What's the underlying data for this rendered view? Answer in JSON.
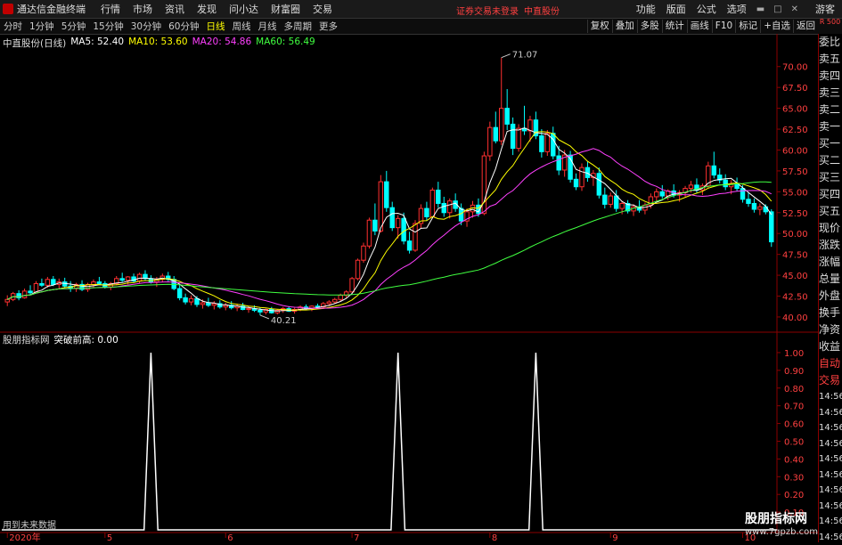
{
  "menubar": {
    "app_title": "通达信金融终端",
    "items": [
      "行情",
      "市场",
      "资讯",
      "发现",
      "问小达",
      "财富圈",
      "交易"
    ],
    "login_note": "证券交易未登录",
    "stock_name": "中直股份",
    "right_items": [
      "功能",
      "版面",
      "公式",
      "选项"
    ],
    "guest": "游客"
  },
  "toolbar": {
    "periods": [
      "分时",
      "1分钟",
      "5分钟",
      "15分钟",
      "30分钟",
      "60分钟",
      "日线",
      "周线",
      "月线",
      "多周期",
      "更多"
    ],
    "active": "日线",
    "right_buttons": [
      "复权",
      "叠加",
      "多股",
      "统计",
      "画线",
      "F10",
      "标记",
      "+自选",
      "返回"
    ],
    "side_tab": "R 500"
  },
  "info": {
    "stock": "中直股份(日线)",
    "ma5_label": "MA5: 52.40",
    "ma10_label": "MA10: 53.60",
    "ma20_label": "MA20: 54.86",
    "ma60_label": "MA60: 56.49",
    "ma5_color": "#ffffff",
    "ma10_color": "#ffff00",
    "ma20_color": "#ff40ff",
    "ma60_color": "#40ff40"
  },
  "indicator": {
    "name": "股朋指标网",
    "field": "突破前高: 0.00"
  },
  "price_annotations": {
    "high": "71.07",
    "low": "40.21"
  },
  "future_data": "用到未来数据",
  "side_panel": [
    "委比",
    "卖五",
    "卖四",
    "卖三",
    "卖二",
    "卖一",
    "买一",
    "买二",
    "买三",
    "买四",
    "买五",
    "现价",
    "涨跌",
    "涨幅",
    "总量",
    "外盘",
    "换手",
    "净资",
    "收益",
    "自动",
    "交易",
    "14:56",
    "14:56",
    "14:56",
    "14:56",
    "14:56",
    "14:56",
    "14:56",
    "14:56",
    "14:56",
    "14:56"
  ],
  "watermark": {
    "main": "股朋指标网",
    "sub": "www.7gpzb.com"
  },
  "chart_data": [
    {
      "type": "candlestick",
      "y_ticks": [
        40.0,
        42.5,
        45.0,
        47.5,
        50.0,
        52.5,
        55.0,
        57.5,
        60.0,
        62.5,
        65.0,
        67.5,
        70.0
      ],
      "ylim": [
        38.5,
        72.0
      ],
      "x_labels": [
        {
          "label": "2020年",
          "index": 0
        },
        {
          "label": "5",
          "index": 17
        },
        {
          "label": "6",
          "index": 38
        },
        {
          "label": "7",
          "index": 60
        },
        {
          "label": "8",
          "index": 84
        },
        {
          "label": "9",
          "index": 105
        },
        {
          "label": "10",
          "index": 128
        }
      ],
      "candles": [
        [
          41.8,
          42.6,
          41.3,
          42.1
        ],
        [
          42.1,
          43.0,
          41.9,
          42.8
        ],
        [
          42.8,
          43.2,
          42.0,
          42.3
        ],
        [
          42.3,
          43.4,
          42.2,
          43.1
        ],
        [
          43.1,
          43.8,
          42.7,
          42.9
        ],
        [
          42.9,
          44.3,
          42.8,
          44.0
        ],
        [
          44.0,
          44.6,
          43.6,
          43.8
        ],
        [
          43.8,
          44.8,
          43.5,
          44.5
        ],
        [
          44.5,
          44.9,
          43.7,
          43.9
        ],
        [
          43.9,
          44.6,
          43.4,
          44.2
        ],
        [
          44.2,
          44.7,
          43.5,
          43.7
        ],
        [
          43.7,
          44.3,
          43.0,
          43.4
        ],
        [
          43.4,
          44.1,
          43.0,
          43.9
        ],
        [
          43.9,
          44.4,
          43.1,
          43.3
        ],
        [
          43.3,
          44.1,
          43.0,
          43.9
        ],
        [
          43.9,
          44.5,
          43.5,
          44.2
        ],
        [
          44.2,
          44.8,
          43.9,
          44.0
        ],
        [
          44.0,
          44.3,
          43.4,
          43.6
        ],
        [
          43.6,
          44.2,
          43.2,
          44.0
        ],
        [
          44.0,
          44.9,
          43.8,
          44.6
        ],
        [
          44.6,
          45.3,
          44.2,
          44.4
        ],
        [
          44.4,
          44.9,
          43.9,
          44.8
        ],
        [
          44.8,
          45.2,
          44.1,
          44.3
        ],
        [
          44.3,
          45.3,
          44.0,
          45.1
        ],
        [
          45.1,
          45.6,
          44.4,
          44.6
        ],
        [
          44.6,
          45.0,
          44.0,
          44.2
        ],
        [
          44.2,
          44.8,
          43.6,
          44.5
        ],
        [
          44.5,
          45.2,
          44.2,
          44.9
        ],
        [
          44.9,
          45.4,
          44.3,
          44.5
        ],
        [
          44.5,
          44.9,
          43.2,
          43.4
        ],
        [
          43.4,
          43.8,
          42.0,
          42.3
        ],
        [
          42.3,
          42.8,
          41.5,
          41.8
        ],
        [
          41.8,
          42.6,
          41.4,
          42.2
        ],
        [
          42.2,
          42.5,
          41.2,
          41.5
        ],
        [
          41.5,
          42.1,
          41.0,
          41.7
        ],
        [
          41.7,
          42.3,
          41.2,
          41.4
        ],
        [
          41.4,
          41.9,
          40.9,
          41.6
        ],
        [
          41.6,
          42.0,
          41.0,
          41.2
        ],
        [
          41.2,
          41.7,
          40.8,
          41.4
        ],
        [
          41.4,
          41.9,
          40.9,
          41.1
        ],
        [
          41.1,
          41.6,
          40.7,
          41.3
        ],
        [
          41.3,
          41.7,
          40.8,
          40.9
        ],
        [
          40.9,
          41.3,
          40.5,
          41.0
        ],
        [
          41.0,
          41.4,
          40.6,
          40.8
        ],
        [
          40.8,
          41.1,
          40.21,
          40.6
        ],
        [
          40.6,
          41.0,
          40.3,
          40.9
        ],
        [
          40.9,
          41.2,
          40.4,
          40.5
        ],
        [
          40.5,
          40.9,
          40.3,
          40.8
        ],
        [
          40.8,
          41.2,
          40.5,
          41.0
        ],
        [
          41.0,
          41.3,
          40.6,
          40.7
        ],
        [
          40.7,
          41.1,
          40.4,
          40.9
        ],
        [
          40.9,
          41.4,
          40.7,
          41.2
        ],
        [
          41.2,
          41.5,
          40.8,
          41.0
        ],
        [
          41.0,
          41.4,
          40.7,
          41.3
        ],
        [
          41.3,
          41.6,
          41.0,
          41.2
        ],
        [
          41.2,
          41.8,
          41.0,
          41.6
        ],
        [
          41.6,
          42.0,
          41.3,
          41.8
        ],
        [
          41.8,
          42.3,
          41.6,
          42.1
        ],
        [
          42.1,
          42.8,
          41.9,
          42.6
        ],
        [
          42.6,
          43.2,
          42.3,
          43.0
        ],
        [
          43.0,
          44.8,
          42.9,
          44.6
        ],
        [
          44.6,
          47.0,
          44.4,
          46.8
        ],
        [
          46.8,
          48.9,
          46.5,
          48.5
        ],
        [
          48.5,
          51.9,
          48.2,
          51.6
        ],
        [
          51.6,
          53.6,
          49.8,
          50.3
        ],
        [
          50.3,
          57.0,
          50.1,
          56.2
        ],
        [
          56.2,
          57.5,
          52.6,
          53.1
        ],
        [
          53.1,
          53.8,
          50.3,
          50.7
        ],
        [
          50.7,
          52.2,
          49.4,
          51.8
        ],
        [
          51.8,
          52.5,
          48.7,
          49.1
        ],
        [
          49.1,
          50.2,
          47.6,
          48.0
        ],
        [
          48.0,
          51.6,
          47.8,
          51.2
        ],
        [
          51.2,
          53.5,
          50.6,
          53.0
        ],
        [
          53.0,
          53.8,
          51.5,
          52.0
        ],
        [
          52.0,
          55.5,
          51.8,
          55.2
        ],
        [
          55.2,
          56.2,
          53.1,
          53.6
        ],
        [
          53.6,
          54.4,
          52.0,
          52.5
        ],
        [
          52.5,
          54.2,
          51.8,
          53.9
        ],
        [
          53.9,
          54.8,
          52.6,
          53.0
        ],
        [
          53.0,
          53.6,
          51.0,
          51.5
        ],
        [
          51.5,
          53.0,
          50.8,
          52.6
        ],
        [
          52.6,
          53.9,
          51.9,
          53.4
        ],
        [
          53.4,
          54.2,
          52.0,
          52.4
        ],
        [
          52.4,
          59.8,
          52.2,
          59.3
        ],
        [
          59.3,
          63.4,
          58.7,
          62.7
        ],
        [
          62.7,
          64.6,
          60.8,
          61.1
        ],
        [
          61.1,
          71.07,
          60.6,
          65.0
        ],
        [
          65.0,
          67.3,
          62.4,
          63.1
        ],
        [
          63.1,
          63.9,
          59.4,
          60.2
        ],
        [
          60.2,
          63.1,
          59.8,
          62.6
        ],
        [
          62.6,
          65.3,
          61.8,
          62.3
        ],
        [
          62.3,
          64.1,
          61.0,
          63.6
        ],
        [
          63.6,
          64.6,
          61.3,
          61.7
        ],
        [
          61.7,
          62.5,
          59.1,
          59.8
        ],
        [
          59.8,
          62.4,
          59.3,
          62.0
        ],
        [
          62.0,
          62.8,
          58.9,
          59.3
        ],
        [
          59.3,
          60.5,
          57.0,
          57.6
        ],
        [
          57.6,
          60.0,
          56.8,
          59.4
        ],
        [
          59.4,
          59.9,
          56.1,
          56.5
        ],
        [
          56.5,
          57.2,
          55.2,
          55.6
        ],
        [
          55.6,
          58.4,
          55.1,
          57.9
        ],
        [
          57.9,
          58.6,
          56.2,
          56.7
        ],
        [
          56.7,
          57.6,
          55.7,
          57.2
        ],
        [
          57.2,
          57.9,
          54.2,
          54.6
        ],
        [
          54.6,
          55.5,
          53.0,
          53.5
        ],
        [
          53.5,
          54.9,
          53.1,
          54.5
        ],
        [
          54.5,
          55.2,
          52.6,
          53.0
        ],
        [
          53.0,
          53.9,
          52.3,
          53.6
        ],
        [
          53.6,
          54.0,
          52.4,
          52.7
        ],
        [
          52.7,
          53.5,
          52.1,
          53.2
        ],
        [
          53.2,
          54.0,
          52.5,
          52.8
        ],
        [
          52.8,
          53.7,
          52.3,
          53.4
        ],
        [
          53.4,
          54.8,
          53.0,
          54.4
        ],
        [
          54.4,
          55.4,
          53.9,
          55.0
        ],
        [
          55.0,
          55.8,
          54.2,
          54.5
        ],
        [
          54.5,
          55.3,
          54.0,
          55.1
        ],
        [
          55.1,
          55.9,
          54.3,
          54.6
        ],
        [
          54.6,
          55.2,
          53.8,
          54.9
        ],
        [
          54.9,
          55.7,
          54.4,
          55.4
        ],
        [
          55.4,
          56.3,
          54.9,
          55.8
        ],
        [
          55.8,
          56.6,
          54.9,
          55.2
        ],
        [
          55.2,
          56.0,
          54.6,
          55.7
        ],
        [
          55.7,
          58.6,
          55.4,
          58.1
        ],
        [
          58.1,
          59.8,
          56.6,
          57.0
        ],
        [
          57.0,
          57.8,
          56.0,
          56.4
        ],
        [
          56.4,
          57.1,
          55.2,
          55.6
        ],
        [
          55.6,
          56.4,
          54.7,
          55.9
        ],
        [
          55.9,
          56.7,
          55.1,
          55.4
        ],
        [
          55.4,
          55.8,
          53.7,
          54.1
        ],
        [
          54.1,
          54.9,
          53.2,
          53.6
        ],
        [
          53.6,
          54.2,
          52.5,
          52.9
        ],
        [
          52.9,
          53.6,
          52.2,
          53.2
        ],
        [
          53.2,
          53.5,
          52.3,
          52.6
        ],
        [
          52.6,
          52.9,
          48.4,
          49.0
        ]
      ],
      "ma_periods": [
        5,
        10,
        20,
        60
      ]
    },
    {
      "type": "line",
      "series": [
        {
          "values_note_none": "",
          "spikes_at": [
            25,
            68,
            92
          ],
          "spike_value": 1.0
        }
      ],
      "y_ticks": [
        0.1,
        0.2,
        0.3,
        0.4,
        0.5,
        0.6,
        0.7,
        0.8,
        0.9,
        1.0
      ],
      "ylim": [
        0,
        1.05
      ]
    }
  ]
}
